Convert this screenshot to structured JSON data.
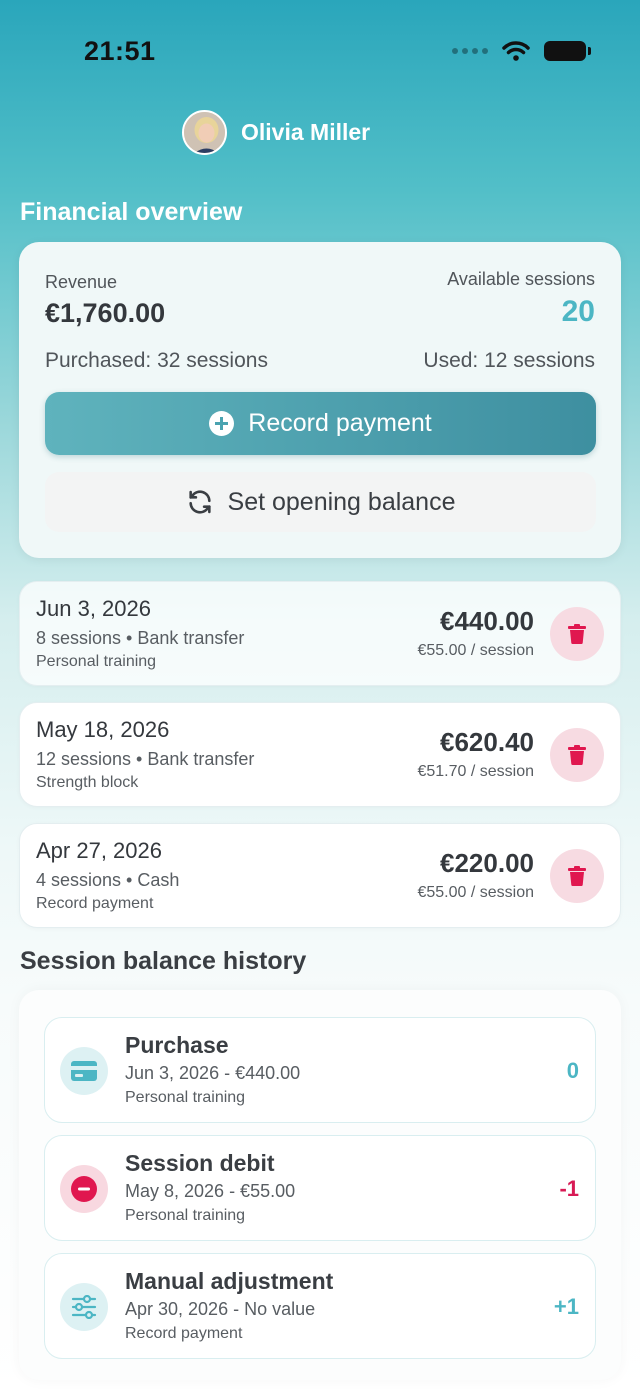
{
  "status_bar": {
    "time": "21:51"
  },
  "profile": {
    "name": "Olivia Miller"
  },
  "overview": {
    "title": "Financial overview",
    "revenue_label": "Revenue",
    "revenue_value": "€1,760.00",
    "available_label": "Available sessions",
    "available_value": "20",
    "purchased_text": "Purchased: 32 sessions",
    "used_text": "Used: 12 sessions",
    "record_payment_label": "Record payment",
    "opening_balance_label": "Set opening balance"
  },
  "transactions": [
    {
      "date": "Jun 3, 2026",
      "meta": "8 sessions • Bank transfer",
      "note": "Personal training",
      "amount": "€440.00",
      "rate": "€55.00 / session"
    },
    {
      "date": "May 18, 2026",
      "meta": "12 sessions • Bank transfer",
      "note": "Strength block",
      "amount": "€620.40",
      "rate": "€51.70 / session"
    },
    {
      "date": "Apr 27, 2026",
      "meta": "4 sessions • Cash",
      "note": "Record payment",
      "amount": "€220.00",
      "rate": "€55.00 / session"
    }
  ],
  "history": {
    "title": "Session balance history",
    "items": [
      {
        "icon": "credit-card-icon",
        "title": "Purchase",
        "sub": "Jun 3, 2026 - €440.00",
        "note": "Personal training",
        "delta": "0",
        "delta_color": "#4cb6c4"
      },
      {
        "icon": "minus-circle-icon",
        "title": "Session debit",
        "sub": "May 8, 2026 - €55.00",
        "note": "Personal training",
        "delta": "-1",
        "delta_color": "#d81b55"
      },
      {
        "icon": "sliders-icon",
        "title": "Manual adjustment",
        "sub": "Apr 30, 2026 - No value",
        "note": "Record payment",
        "delta": "+1",
        "delta_color": "#4cb6c4"
      }
    ]
  },
  "colors": {
    "accent": "#4cb6c4",
    "danger": "#e0174f"
  }
}
